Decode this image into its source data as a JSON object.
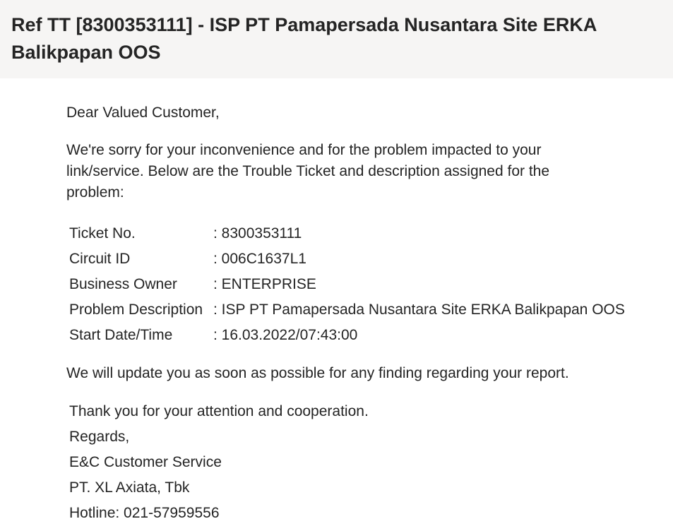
{
  "email": {
    "subject": "Ref TT [8300353111] - ISP PT Pamapersada Nusantara Site ERKA Balikpapan OOS",
    "greeting": "Dear Valued Customer,",
    "intro": "We're sorry for your inconvenience and for the problem impacted to your link/service. Below are the Trouble Ticket and description assigned for the problem:",
    "details": [
      {
        "label": "Ticket No.",
        "value": ": 8300353111"
      },
      {
        "label": "Circuit ID",
        "value": ": 006C1637L1"
      },
      {
        "label": "Business Owner",
        "value": ": ENTERPRISE"
      },
      {
        "label": "Problem Description",
        "value": ": ISP PT Pamapersada Nusantara Site ERKA Balikpapan OOS"
      },
      {
        "label": "Start Date/Time",
        "value": ": 16.03.2022/07:43:00"
      }
    ],
    "update_note": "We will update you as soon as possible for any finding regarding your report.",
    "closing": [
      "Thank you for your attention and cooperation.",
      "Regards,",
      "E&C Customer Service",
      "PT. XL Axiata, Tbk",
      "Hotline: 021-57959556"
    ]
  }
}
